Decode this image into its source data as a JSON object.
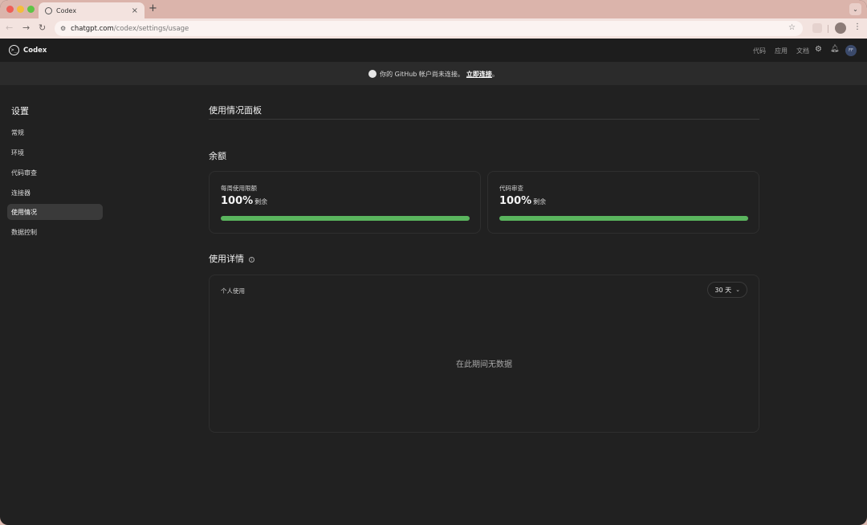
{
  "browser": {
    "tab_title": "Codex",
    "tab_close": "×",
    "new_tab": "+",
    "url_host": "chatgpt.com",
    "url_path": "/codex/settings/usage",
    "tab_menu": "⌄"
  },
  "header": {
    "logo_text": "Codex",
    "links": [
      "代码",
      "应用",
      "文档"
    ],
    "avatar_initials": "FF"
  },
  "banner": {
    "text": "你的 GitHub 帐户尚未连接。",
    "link": "立即连接",
    "suffix": "。"
  },
  "sidebar": {
    "title": "设置",
    "items": [
      {
        "label": "常规",
        "active": false
      },
      {
        "label": "环境",
        "active": false
      },
      {
        "label": "代码审查",
        "active": false
      },
      {
        "label": "连接器",
        "active": false
      },
      {
        "label": "使用情况",
        "active": true
      },
      {
        "label": "数据控制",
        "active": false
      }
    ]
  },
  "main": {
    "page_title": "使用情况面板",
    "balance_title": "余额",
    "cards": [
      {
        "label": "每周使用限额",
        "value": "100%",
        "suffix": "剩余",
        "progress": 1.0
      },
      {
        "label": "代码审查",
        "value": "100%",
        "suffix": "剩余",
        "progress": 1.0
      }
    ],
    "details_title": "使用详情",
    "details_label": "个人使用",
    "range_value": "30 天",
    "empty_text": "在此期间无数据"
  },
  "colors": {
    "accent_green": "#5ab55e",
    "background": "#212121"
  }
}
